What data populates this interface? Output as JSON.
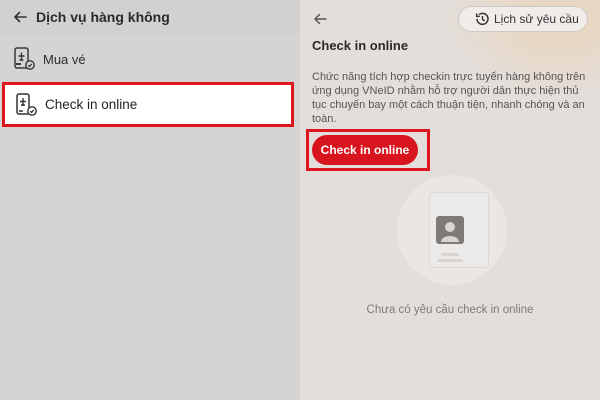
{
  "left": {
    "title": "Dịch vụ hàng không",
    "menu": [
      {
        "label": "Mua vé",
        "icon": "ticket-plane-icon"
      },
      {
        "label": "Check in online",
        "icon": "phone-plane-check-icon"
      }
    ]
  },
  "right": {
    "history_label": "Lịch sử yêu cầu",
    "page_title": "Check in online",
    "description": "Chức năng tích hợp checkin trực tuyến hàng không trên ứng dụng VNeID nhằm hỗ trợ người dân thực hiện thủ tục chuyến bay một cách thuận tiện, nhanh chóng và an toàn.",
    "cta_label": "Check in online",
    "empty_text": "Chưa có yêu cầu check in online"
  },
  "colors": {
    "accent_red": "#d8141e",
    "highlight_red": "#e0161e"
  }
}
